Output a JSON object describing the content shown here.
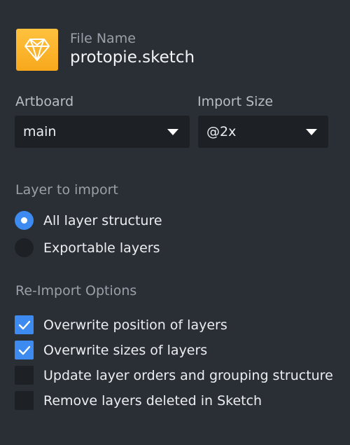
{
  "file": {
    "label": "File Name",
    "value": "protopie.sketch",
    "icon": "sketch-diamond-icon"
  },
  "artboard": {
    "label": "Artboard",
    "value": "main"
  },
  "import_size": {
    "label": "Import Size",
    "value": "@2x"
  },
  "layer_to_import": {
    "title": "Layer to import",
    "options": [
      {
        "label": "All layer structure",
        "selected": true
      },
      {
        "label": "Exportable layers",
        "selected": false
      }
    ]
  },
  "reimport": {
    "title": "Re-Import Options",
    "options": [
      {
        "label": "Overwrite position of layers",
        "checked": true
      },
      {
        "label": "Overwrite sizes of layers",
        "checked": true
      },
      {
        "label": "Update layer orders and grouping structure",
        "checked": false
      },
      {
        "label": "Remove layers deleted in Sketch",
        "checked": false
      }
    ]
  },
  "colors": {
    "background": "#2a2e35",
    "control": "#1d2025",
    "accent": "#3d8bf0",
    "icon_gold": "#f7a81c"
  }
}
